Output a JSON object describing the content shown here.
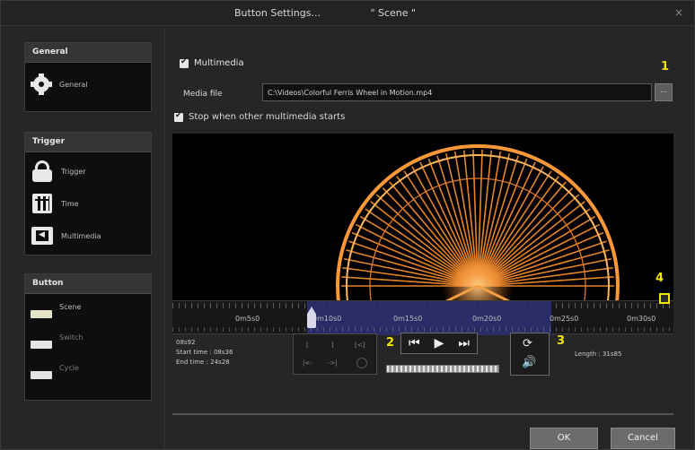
{
  "window": {
    "title": "Button Settings...",
    "scene_title": "\" Scene \"",
    "close_glyph": "×"
  },
  "sidebar": {
    "general": {
      "header": "General",
      "items": [
        {
          "label": "General",
          "icon": "gear-icon"
        }
      ]
    },
    "trigger": {
      "header": "Trigger",
      "items": [
        {
          "label": "Trigger",
          "icon": "lock-icon"
        },
        {
          "label": "Time",
          "icon": "calendar-icon"
        },
        {
          "label": "Multimedia",
          "icon": "multimedia-icon"
        }
      ]
    },
    "button": {
      "header": "Button",
      "items": [
        {
          "label": "Scene",
          "icon": "button-swatch-icon"
        },
        {
          "label": "Switch",
          "icon": "button-swatch-icon"
        },
        {
          "label": "Cycle",
          "icon": "button-swatch-icon"
        }
      ]
    }
  },
  "main": {
    "multimedia_label": "Multimedia",
    "media_file_label": "Media file",
    "media_file_value": "C:\\Videos\\Colorful Ferris Wheel in Motion.mp4",
    "browse_label": "...",
    "stop_label": "Stop when other multimedia starts",
    "callouts": [
      "1",
      "2",
      "3",
      "4"
    ],
    "timeline": {
      "labels": [
        "0m5s0",
        "0m10s0",
        "0m15s0",
        "0m20s0",
        "0m25s0",
        "0m30s0"
      ],
      "range_start": "0m10s0",
      "range_end": "0m25s0"
    },
    "current_time": "08s92",
    "start_time": "Start time : 08s36",
    "end_time": "End time : 24s28",
    "edit_buttons": [
      "[",
      "]",
      "[<]",
      "|<-",
      "->|"
    ],
    "length": "Length : 31s85",
    "ok_label": "OK",
    "cancel_label": "Cancel"
  },
  "colors": {
    "callout": "#f2e600",
    "timeline_range": "#2a2d6b",
    "panel_bg": "#262626"
  }
}
